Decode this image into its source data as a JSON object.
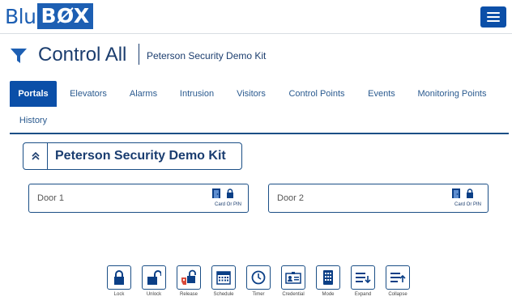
{
  "app": {
    "logo_text_left": "Blu",
    "logo_text_box": "BØX",
    "brand_color": "#1d5fb3",
    "accent_color": "#0b4fa8"
  },
  "header": {
    "title": "Control All",
    "subtitle": "Peterson Security Demo Kit",
    "filter_icon": "filter-icon",
    "menu_icon": "hamburger-menu-icon"
  },
  "tabs": [
    {
      "label": "Portals",
      "active": true
    },
    {
      "label": "Elevators",
      "active": false
    },
    {
      "label": "Alarms",
      "active": false
    },
    {
      "label": "Intrusion",
      "active": false
    },
    {
      "label": "Visitors",
      "active": false
    },
    {
      "label": "Control Points",
      "active": false
    },
    {
      "label": "Events",
      "active": false
    },
    {
      "label": "Monitoring Points",
      "active": false
    },
    {
      "label": "History",
      "active": false
    }
  ],
  "group": {
    "title": "Peterson Security Demo Kit",
    "collapse_icon": "double-chevron-up-icon"
  },
  "doors": [
    {
      "name": "Door 1",
      "mode": "Card Or PIN"
    },
    {
      "name": "Door 2",
      "mode": "Card Or PIN"
    }
  ],
  "toolbar": [
    {
      "label": "Lock",
      "icon": "lock-icon"
    },
    {
      "label": "Unlock",
      "icon": "unlock-icon"
    },
    {
      "label": "Release",
      "icon": "release-icon"
    },
    {
      "label": "Schedule",
      "icon": "schedule-icon"
    },
    {
      "label": "Timer",
      "icon": "timer-icon"
    },
    {
      "label": "Credential",
      "icon": "credential-icon"
    },
    {
      "label": "Mode",
      "icon": "mode-icon"
    },
    {
      "label": "Expand",
      "icon": "expand-icon"
    },
    {
      "label": "Collapse",
      "icon": "collapse-icon"
    }
  ]
}
